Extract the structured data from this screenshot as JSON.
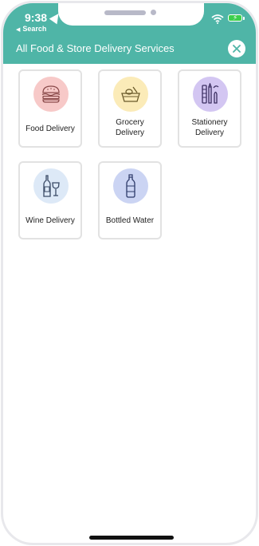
{
  "status_bar": {
    "time": "9:38",
    "back_app": "Search"
  },
  "header": {
    "title": "All Food & Store Delivery Services",
    "accent_color": "#4fb5a7"
  },
  "services": [
    {
      "label": "Food Delivery",
      "icon": "burger-icon",
      "bg": "#f7c9c8"
    },
    {
      "label": "Grocery Delivery",
      "icon": "grocery-basket-icon",
      "bg": "#fbebb8"
    },
    {
      "label": "Stationery Delivery",
      "icon": "stationery-icon",
      "bg": "#d3c6f2"
    },
    {
      "label": "Wine Delivery",
      "icon": "wine-icon",
      "bg": "#dde9f7"
    },
    {
      "label": "Bottled Water",
      "icon": "water-bottle-icon",
      "bg": "#cbd4f3"
    }
  ]
}
